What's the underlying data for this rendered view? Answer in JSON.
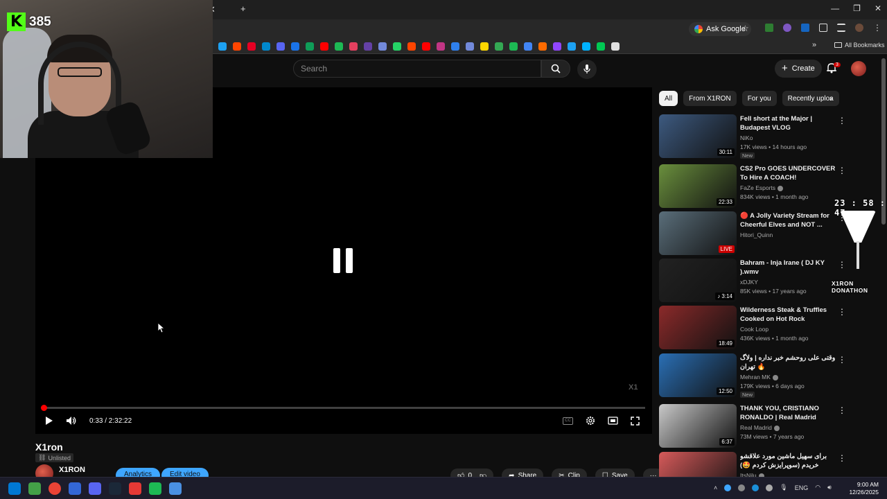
{
  "webcam": {
    "kick_logo": "K",
    "viewer_count": "385"
  },
  "browser": {
    "tab_close": "✕",
    "new_tab": "+",
    "ask_google_label": "Ask Google",
    "all_bookmarks_label": "All Bookmarks",
    "bookmark_colors": [
      "#1da1f2",
      "#ff4500",
      "#e60023",
      "#0088cc",
      "#5865f2",
      "#1a73e8",
      "#0f9d58",
      "#ff0000",
      "#1db954",
      "#e4405f",
      "#6441a5",
      "#7289da",
      "#25d366",
      "#ff4500",
      "#ff0000",
      "#c13584",
      "#2f80ed",
      "#7289da",
      "#ffd700",
      "#34a853",
      "#1db954",
      "#4285f4",
      "#ff6b00",
      "#9146ff",
      "#1da1f2",
      "#00b2ff",
      "#00c853",
      "#e0e0e0"
    ]
  },
  "header": {
    "search_placeholder": "Search",
    "create_label": "Create",
    "notification_count": "3"
  },
  "player": {
    "current_time": "0:33",
    "duration": "2:32:22",
    "time_display": "0:33 / 2:32:22",
    "progress_fraction": 0.0036,
    "watermark": "X1",
    "cc_label": "CC"
  },
  "video": {
    "title": "X1ron",
    "visibility": "Unlisted",
    "channel_name": "X1RON",
    "analytics_label": "Analytics",
    "edit_label": "Edit video",
    "like_count": "0",
    "share_label": "Share",
    "clip_label": "Clip",
    "save_label": "Save"
  },
  "sidebar": {
    "chips": [
      "All",
      "From X1RON",
      "For you",
      "Recently uploa"
    ],
    "recommendations": [
      {
        "title": "Fell short at the Major | Budapest VLOG",
        "channel": "NiKo",
        "verified": false,
        "meta": "17K views • 14 hours ago",
        "badge": "New",
        "duration": "30:11",
        "live": false,
        "thumb_color": "#3d5a80"
      },
      {
        "title": "CS2 Pro GOES UNDERCOVER To Hire A COACH!",
        "channel": "FaZe Esports",
        "verified": true,
        "meta": "834K views • 1 month ago",
        "badge": "",
        "duration": "22:33",
        "live": false,
        "thumb_color": "#6a8f3d"
      },
      {
        "title": "🔴 A Jolly Variety Stream for Cheerful Elves and NOT ...",
        "channel": "Hitori_Quinn",
        "verified": false,
        "meta": "",
        "badge": "",
        "duration": "LIVE",
        "live": true,
        "thumb_color": "#5a6e7a"
      },
      {
        "title": "Bahram - Inja Irane ( DJ KY ).wmv",
        "channel": "xDJKY",
        "verified": false,
        "meta": "85K views • 17 years ago",
        "badge": "",
        "duration": "♪ 3:14",
        "live": false,
        "thumb_color": "#222222"
      },
      {
        "title": "Wilderness Steak & Truffles Cooked on Hot Rock",
        "channel": "Cook Loop",
        "verified": false,
        "meta": "436K views • 1 month ago",
        "badge": "",
        "duration": "18:49",
        "live": false,
        "thumb_color": "#8b2a2a"
      },
      {
        "title": "وقتی علی روحشم خبر نداره | ولاگ تهران 🔥",
        "channel": "Mehran MK",
        "verified": true,
        "meta": "179K views • 6 days ago",
        "badge": "New",
        "duration": "12:50",
        "live": false,
        "thumb_color": "#2a6fb5"
      },
      {
        "title": "THANK YOU, CRISTIANO RONALDO | Real Madrid Offici...",
        "channel": "Real Madrid",
        "verified": true,
        "meta": "73M views • 7 years ago",
        "badge": "",
        "duration": "6:37",
        "live": false,
        "thumb_color": "#c9c9c9"
      },
      {
        "title": "برای سهیل ماشین مورد علاقشو خریدم (سوپرایزش کردم 🤩)",
        "channel": "ItsNilu",
        "verified": true,
        "meta": "",
        "badge": "",
        "duration": "",
        "live": false,
        "thumb_color": "#d65a5a"
      }
    ]
  },
  "donathon": {
    "timer": "23 : 58 : 47",
    "label": "X1RON DONATHON"
  },
  "taskbar": {
    "icon_colors": [
      "#0078d4",
      "#43a047",
      "#ea4335",
      "#3367d6",
      "#5865f2",
      "#1b2838",
      "#e53935",
      "#1db954",
      "#4a90e2"
    ],
    "language": "ENG",
    "time": "9:00 AM",
    "date": "12/26/2025"
  }
}
